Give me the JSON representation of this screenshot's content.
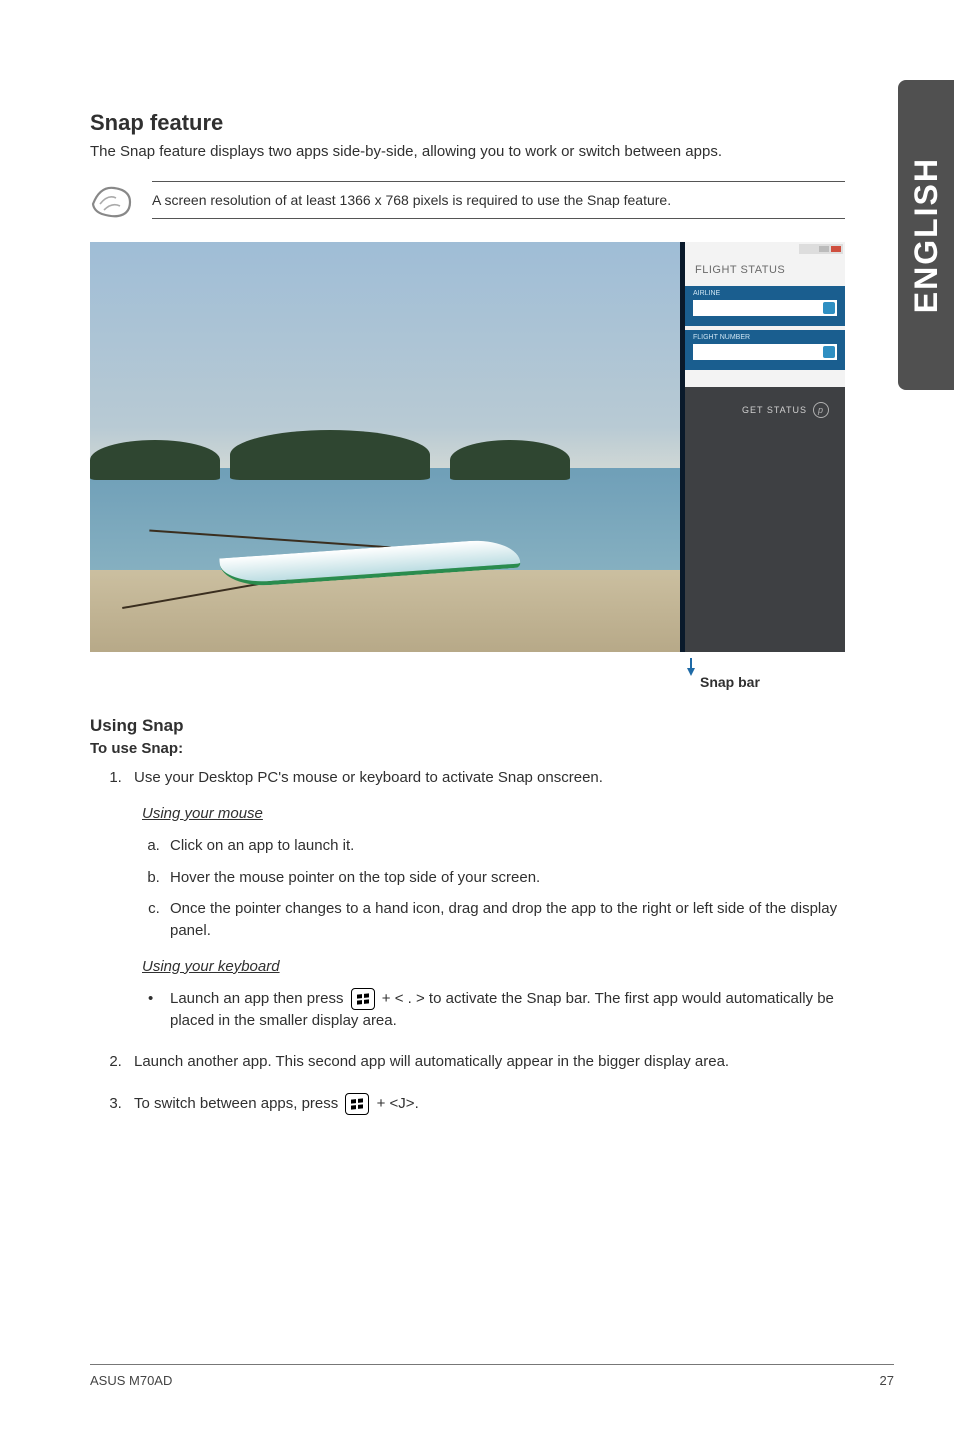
{
  "side_tab": "ENGLISH",
  "h_snap": "Snap feature",
  "snap_lead": "The Snap feature displays two apps side-by-side, allowing you to work or switch between apps.",
  "note_text": "A screen resolution of at least 1366 x 768 pixels is required to use the Snap feature.",
  "flight_panel": {
    "title": "FLIGHT STATUS",
    "airline_lbl": "AIRLINE",
    "flight_lbl": "FLIGHT NUMBER",
    "btn": "GET STATUS"
  },
  "snap_bar_label": "Snap bar",
  "h_using": "Using Snap",
  "to_use": "To use Snap:",
  "step1": "Use your Desktop PC's mouse or keyboard to activate Snap onscreen.",
  "mouse_hdr": "Using your mouse",
  "mouse": {
    "a": "Click on an app to launch it.",
    "b": "Hover the mouse pointer on the top side of your screen.",
    "c": "Once the pointer changes to a hand icon, drag and drop the app to the right or left side of the display panel."
  },
  "kb_hdr": "Using your keyboard",
  "kb_bullet_pre": "Launch an app then press ",
  "kb_bullet_post": " + < . > to activate the Snap bar. The first app would automatically be placed in the smaller display area.",
  "step2": "Launch another app. This second app will automatically appear in the bigger display area.",
  "step3_pre": "To switch between apps, press ",
  "step3_post": " + <J>.",
  "footer_left": "ASUS M70AD",
  "footer_right": "27"
}
